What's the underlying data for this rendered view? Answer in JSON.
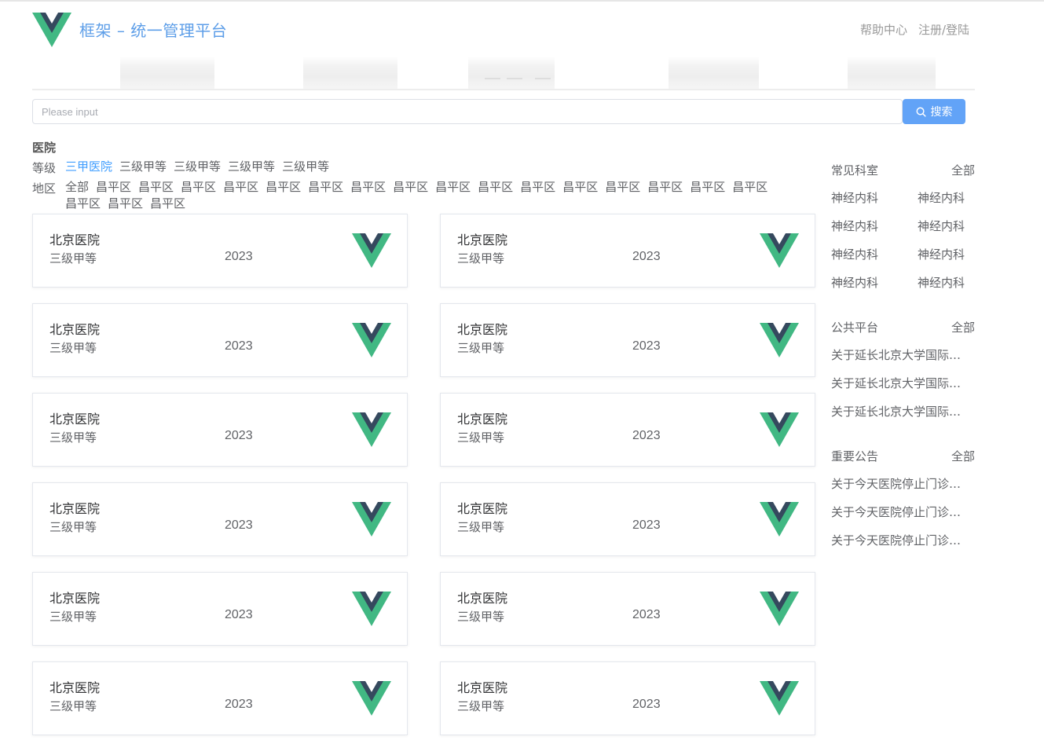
{
  "header": {
    "title": "框架 – 统一管理平台",
    "help": "帮助中心",
    "login": "注册/登陆"
  },
  "search": {
    "placeholder": "Please input",
    "button": "搜索"
  },
  "filters": {
    "title": "医院",
    "level_label": "等级",
    "levels": [
      "三甲医院",
      "三级甲等",
      "三级甲等",
      "三级甲等",
      "三级甲等"
    ],
    "region_label": "地区",
    "regions": [
      "全部",
      "昌平区",
      "昌平区",
      "昌平区",
      "昌平区",
      "昌平区",
      "昌平区",
      "昌平区",
      "昌平区",
      "昌平区",
      "昌平区",
      "昌平区",
      "昌平区",
      "昌平区",
      "昌平区",
      "昌平区",
      "昌平区",
      "昌平区",
      "昌平区",
      "昌平区"
    ]
  },
  "hospitals": [
    {
      "name": "北京医院",
      "level": "三级甲等",
      "time": "2023"
    },
    {
      "name": "北京医院",
      "level": "三级甲等",
      "time": "2023"
    },
    {
      "name": "北京医院",
      "level": "三级甲等",
      "time": "2023"
    },
    {
      "name": "北京医院",
      "level": "三级甲等",
      "time": "2023"
    },
    {
      "name": "北京医院",
      "level": "三级甲等",
      "time": "2023"
    },
    {
      "name": "北京医院",
      "level": "三级甲等",
      "time": "2023"
    },
    {
      "name": "北京医院",
      "level": "三级甲等",
      "time": "2023"
    },
    {
      "name": "北京医院",
      "level": "三级甲等",
      "time": "2023"
    },
    {
      "name": "北京医院",
      "level": "三级甲等",
      "time": "2023"
    },
    {
      "name": "北京医院",
      "level": "三级甲等",
      "time": "2023"
    },
    {
      "name": "北京医院",
      "level": "三级甲等",
      "time": "2023"
    },
    {
      "name": "北京医院",
      "level": "三级甲等",
      "time": "2023"
    }
  ],
  "sidebar": {
    "departments": {
      "title": "常见科室",
      "all": "全部",
      "items": [
        "神经内科",
        "神经内科",
        "神经内科",
        "神经内科",
        "神经内科",
        "神经内科",
        "神经内科",
        "神经内科"
      ]
    },
    "platform": {
      "title": "公共平台",
      "all": "全部",
      "items": [
        "关于延长北京大学国际医院...",
        "关于延长北京大学国际医院...",
        "关于延长北京大学国际医院..."
      ]
    },
    "notices": {
      "title": "重要公告",
      "all": "全部",
      "items": [
        "关于今天医院停止门诊的通知",
        "关于今天医院停止门诊的通知",
        "关于今天医院停止门诊的通知"
      ]
    }
  },
  "colors": {
    "accent": "#409eff",
    "button": "#62a3f7",
    "title": "#5d9ee8",
    "logo_green": "#41b883",
    "logo_dark": "#35495e"
  }
}
